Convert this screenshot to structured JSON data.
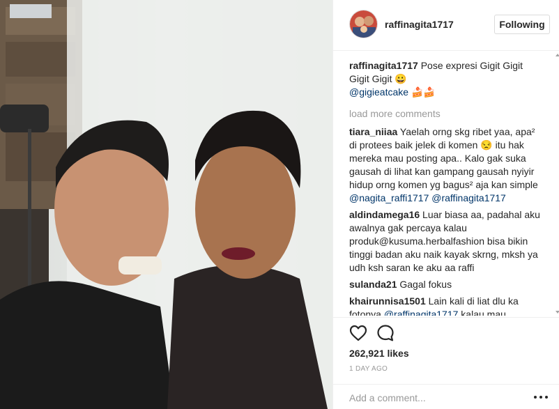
{
  "post": {
    "username": "raffinagita1717",
    "follow_label": "Following",
    "caption": {
      "user": "raffinagita1717",
      "text": "Pose expresi Gigit Gigit Gigit Gigit 😀",
      "mention": "@gigieatcake",
      "emoji": "🍰🍰"
    },
    "load_more_label": "load more comments",
    "comments": [
      {
        "user": "tiara_niiaa",
        "text": "Yaelah orng skg ribet yaa, apa² di protees baik jelek di komen 😒 itu hak mereka mau posting apa.. Kalo gak suka gausah di lihat kan gampang gausah nyiyir hidup orng komen yg bagus² aja kan simple ",
        "mentions": "@nagita_raffi1717 @raffinagita1717"
      },
      {
        "user": "aldindamega16",
        "text": "Luar biasa aa, padahal aku awalnya gak percaya kalau produk@kusuma.herbalfashion bisa bikin tinggi badan aku naik kayak skrng, mksh ya udh ksh saran ke aku aa raffi"
      },
      {
        "user": "sulanda21",
        "text": "Gagal fokus"
      },
      {
        "user": "khairunnisa1501",
        "text": "Lain kali di liat dlu ka fotonya ",
        "mention": "@raffinagita1717",
        "text_after": " kalau mau posting, kan kk artis seharusya dpt"
      }
    ],
    "likes": "262,921 likes",
    "timestamp": "1 DAY AGO",
    "add_comment_placeholder": "Add a comment..."
  },
  "icons": {
    "like": "heart-outline-icon",
    "comment": "speech-bubble-icon",
    "more": "more-options-icon"
  },
  "colors": {
    "text": "#262626",
    "mention": "#003569",
    "muted": "#999999",
    "border": "#efefef"
  }
}
